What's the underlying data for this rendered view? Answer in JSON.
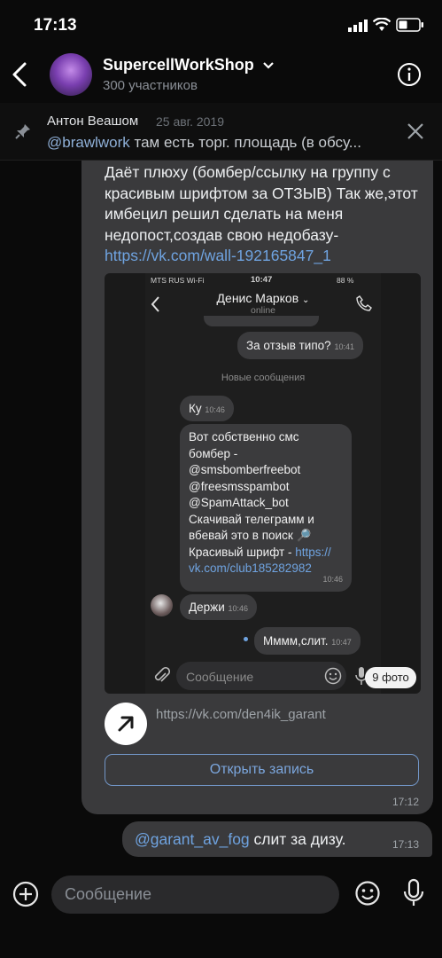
{
  "status": {
    "time": "17:13"
  },
  "header": {
    "title": "SupercellWorkShop",
    "subtitle": "300 участников"
  },
  "pinned": {
    "author": "Антон Веашом",
    "date": "25 авг. 2019",
    "mention": "@brawlwork",
    "text": " там есть торг. площадь (в обсу..."
  },
  "message": {
    "text": "Даёт плюху (бомбер/ссылку на группу с красивым шрифтом за ОТЗЫВ) Так же,этот имбецил решил сделать на меня недопост,создав свою недобазу-",
    "link": "https://vk.com/wall-192165847_1",
    "time": "17:12"
  },
  "embed": {
    "status_carrier": "MTS RUS Wi-Fi",
    "status_time": "10:47",
    "status_battery": "88 %",
    "contact_name": "Денис Марков",
    "contact_status": "online",
    "msg_review": "За отзыв типо?",
    "msg_review_time": "10:41",
    "new_messages": "Новые сообщения",
    "msg_ku": "Ку",
    "msg_ku_time": "10:46",
    "msg_long": "Вот собственно смс бомбер - @smsbomberfreebot @freesmsspambot @SpamAttack_bot Скачивай телеграмм и вбевай это в поиск 🔎 Красивый шрифт - ",
    "msg_long_link": "https:// vk.com/club185282982",
    "msg_long_time": "10:46",
    "msg_hold": "Держи",
    "msg_hold_time": "10:46",
    "msg_mmm": "Мммм,слит.",
    "msg_mmm_time": "10:47",
    "input_placeholder": "Сообщение",
    "photo_count": "9 фото"
  },
  "link_preview": {
    "url": "https://vk.com/den4ik_garant",
    "button": "Открыть запись"
  },
  "message2": {
    "mention": "@garant_av_fog",
    "text": " слит за дизу.",
    "time": "17:13"
  },
  "composer": {
    "placeholder": "Сообщение"
  },
  "colors": {
    "accent": "#6fa3e0",
    "bubble": "#3a3a3c",
    "background": "#0a0a0a"
  }
}
